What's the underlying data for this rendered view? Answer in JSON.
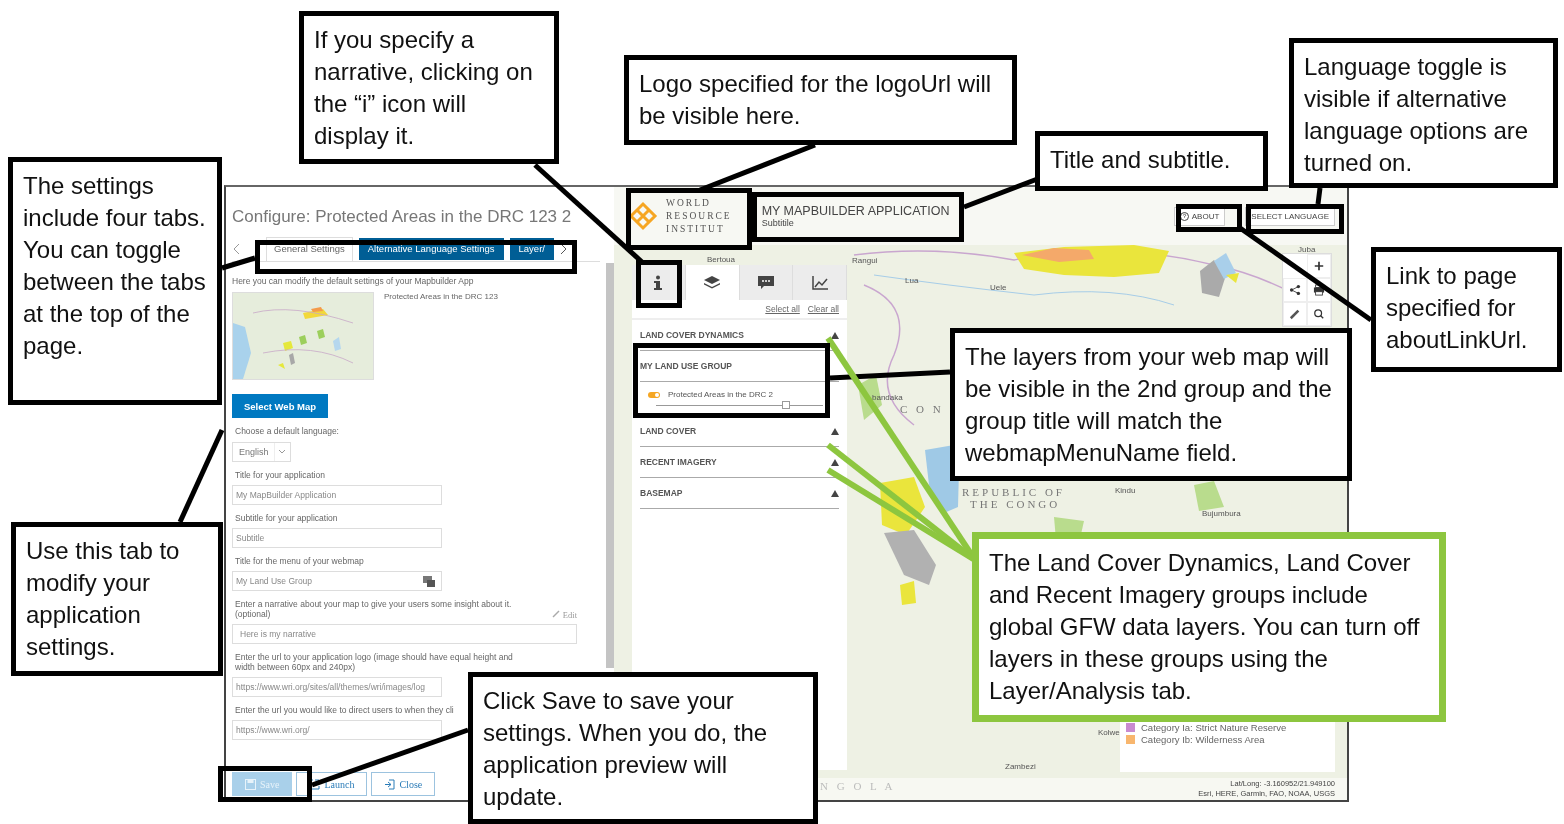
{
  "config_panel": {
    "title": "Configure: Protected Areas in the DRC 123 2",
    "tabs": [
      {
        "label": "General Settings",
        "selected": true
      },
      {
        "label": "Alternative Language Settings",
        "selected": false
      },
      {
        "label": "Layer/",
        "selected": false
      }
    ],
    "intro": "Here you can modify the default settings of your Mapbuilder App",
    "webmap_title": "Protected Areas in the DRC 123",
    "select_button": "Select Web Map",
    "fields": [
      {
        "kind": "select",
        "label": "Choose a default language:",
        "value": "English"
      },
      {
        "kind": "text",
        "label": "Title for your application",
        "value": "My MapBuilder Application"
      },
      {
        "kind": "text",
        "label": "Subtitle for your application",
        "value": "Subtitle"
      },
      {
        "kind": "translate",
        "label": "Title for the menu of your webmap",
        "value": "My Land Use Group"
      },
      {
        "kind": "narrative",
        "label": "Enter a narrative about your map to give your users some insight about it. (optional)",
        "edit": "Edit",
        "value": "Here is my narrative"
      },
      {
        "kind": "text",
        "label": "Enter the url to your application logo (image should have equal height and width between 60px and 240px)",
        "value": "https://www.wri.org/sites/all/themes/wri/images/log"
      },
      {
        "kind": "text",
        "label": "Enter the url you would like to direct users to when they cli",
        "value": "https://www.wri.org/"
      }
    ],
    "buttons": [
      {
        "kind": "save",
        "label": "Save",
        "disabled": true
      },
      {
        "kind": "launch",
        "label": "Launch",
        "disabled": false
      },
      {
        "kind": "close",
        "label": "Close",
        "disabled": false
      }
    ]
  },
  "preview": {
    "logo_lines": [
      "WORLD",
      "RESOURCE",
      "INSTITUT"
    ],
    "app_title": "MY MAPBUILDER APPLICATION",
    "subtitle": "Subtitile",
    "about": "ABOUT",
    "language": "SELECT LANGUAGE",
    "panel_tabs": [
      {
        "kind": "info",
        "selected": false
      },
      {
        "kind": "layers",
        "selected": true
      },
      {
        "kind": "comment",
        "selected": false
      },
      {
        "kind": "chart",
        "selected": false
      }
    ],
    "select_all": "Select all",
    "clear_all": "Clear all",
    "groups": [
      {
        "title": "LAND COVER DYNAMICS",
        "expanded": false
      },
      {
        "title": "MY LAND USE GROUP",
        "expanded": true,
        "layers": [
          {
            "name": "Protected Areas in the DRC 2",
            "on": true,
            "level": 0.78
          }
        ]
      },
      {
        "title": "LAND COVER",
        "expanded": false
      },
      {
        "title": "RECENT IMAGERY",
        "expanded": false
      },
      {
        "title": "BASEMAP",
        "expanded": false
      }
    ],
    "map_labels": [
      "Bertoua",
      "Rangui",
      "Lua",
      "Uele",
      "Juba",
      "bandaka",
      "C O N",
      "REPUBLIC OF",
      "THE CONGO",
      "Kindu",
      "Bujumbura",
      "Kolwe",
      "Zambezi",
      "N G O L A"
    ],
    "legend": [
      {
        "label": "Category Ia: Strict Nature Reserve",
        "color": "#c98bd0"
      },
      {
        "label": "Category Ib: Wilderness Area",
        "color": "#f8b66e"
      }
    ],
    "coordinates": "Lat/Long: -3.160952/21.949100",
    "attribution": "Esri, HERE, Garmin, FAO, NOAA, USGS"
  },
  "callouts": [
    {
      "text": "The settings include four tabs. You can toggle between the tabs at the top of the page.",
      "color": "#000000"
    },
    {
      "text": "If you specify a narrative, clicking on the “i” icon will display it.",
      "color": "#000000"
    },
    {
      "text": "Logo specified for the logoUrl will be visible here.",
      "color": "#000000"
    },
    {
      "text": "Title and subtitle.",
      "color": "#000000"
    },
    {
      "text": "Language toggle is visible if alternative language options are turned on.",
      "color": "#000000"
    },
    {
      "text": "Link to page specified for aboutLinkUrl.",
      "color": "#000000"
    },
    {
      "text": "The layers from your web map will be visible in the 2nd group and the group title will match the webmapMenuName field.",
      "color": "#000000"
    },
    {
      "text": "The Land Cover Dynamics, Land Cover and Recent Imagery groups include global GFW data layers. You can turn off layers in these groups using the Layer/Analysis tab.",
      "color": "#8dc63f"
    },
    {
      "text": "Use this tab to modify your application settings.",
      "color": "#000000"
    },
    {
      "text": "Click Save to save your settings. When you do, the application preview will update.",
      "color": "#000000"
    }
  ]
}
